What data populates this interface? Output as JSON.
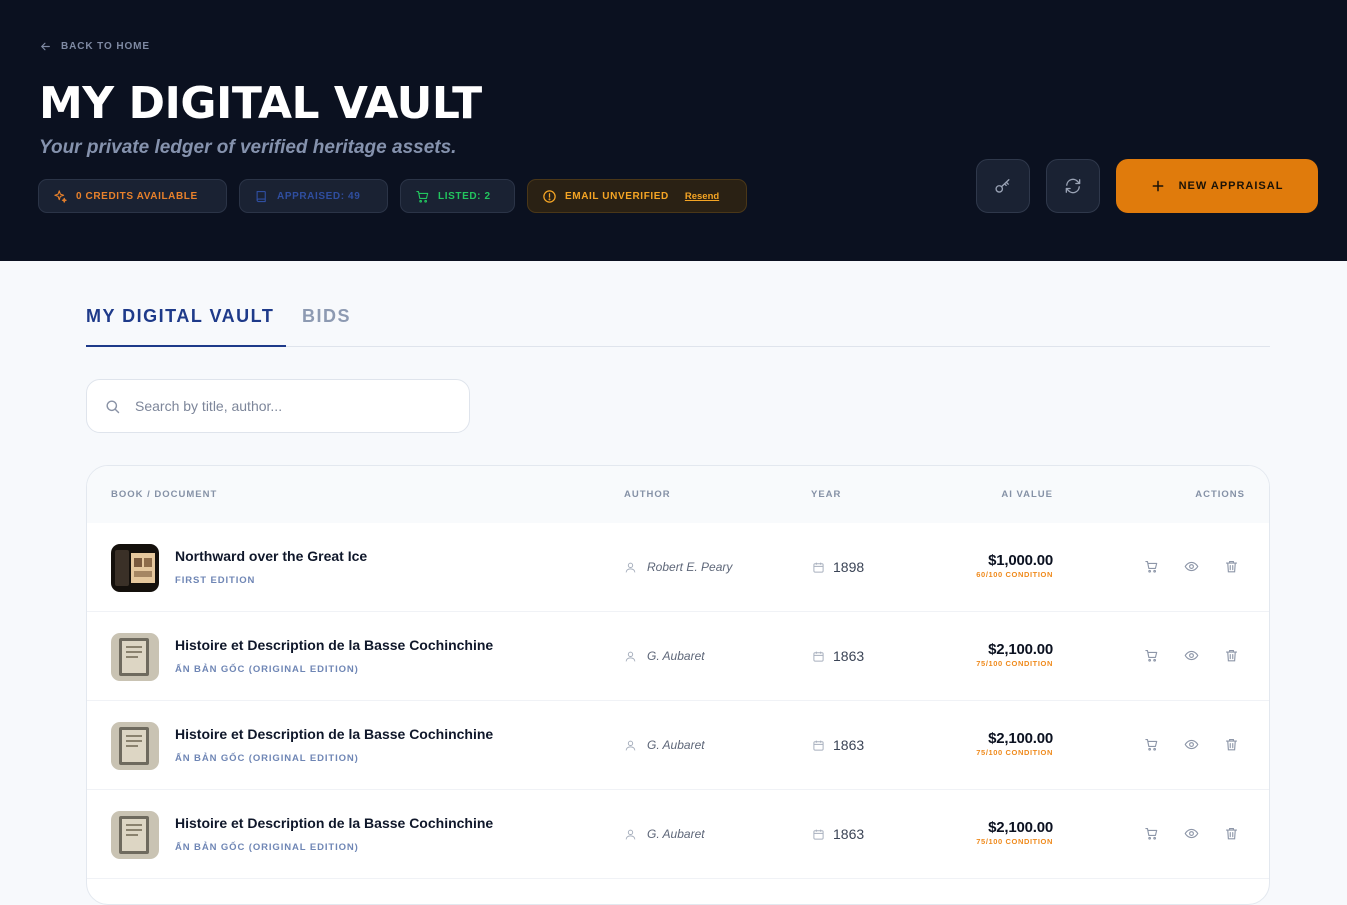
{
  "header": {
    "back_label": "BACK TO HOME",
    "title": "MY DIGITAL VAULT",
    "subtitle": "Your private ledger of verified heritage assets.",
    "stats": {
      "credits": "0 CREDITS AVAILABLE",
      "appraised": "APPRAISED: 49",
      "listed": "LISTED: 2",
      "email_status": "EMAIL UNVERIFIED",
      "resend": "Resend"
    },
    "new_appraisal_label": "NEW APPRAISAL",
    "accent_color": "#e07b0c",
    "background_color": "#0b1120"
  },
  "tabs": [
    {
      "label": "MY DIGITAL VAULT",
      "active": true
    },
    {
      "label": "BIDS",
      "active": false
    }
  ],
  "search": {
    "placeholder": "Search by title, author...",
    "value": ""
  },
  "table": {
    "columns": [
      "BOOK / DOCUMENT",
      "AUTHOR",
      "YEAR",
      "AI VALUE",
      "ACTIONS"
    ],
    "rows": [
      {
        "title": "Northward over the Great Ice",
        "edition": "FIRST EDITION",
        "author": "Robert E. Peary",
        "year": "1898",
        "value": "$1,000.00",
        "condition": "60/100 CONDITION"
      },
      {
        "title": "Histoire et Description de la Basse Cochinchine",
        "edition": "ẤN BẢN GỐC (ORIGINAL EDITION)",
        "author": "G. Aubaret",
        "year": "1863",
        "value": "$2,100.00",
        "condition": "75/100 CONDITION"
      },
      {
        "title": "Histoire et Description de la Basse Cochinchine",
        "edition": "ẤN BẢN GỐC (ORIGINAL EDITION)",
        "author": "G. Aubaret",
        "year": "1863",
        "value": "$2,100.00",
        "condition": "75/100 CONDITION"
      },
      {
        "title": "Histoire et Description de la Basse Cochinchine",
        "edition": "ẤN BẢN GỐC (ORIGINAL EDITION)",
        "author": "G. Aubaret",
        "year": "1863",
        "value": "$2,100.00",
        "condition": "75/100 CONDITION"
      }
    ]
  }
}
